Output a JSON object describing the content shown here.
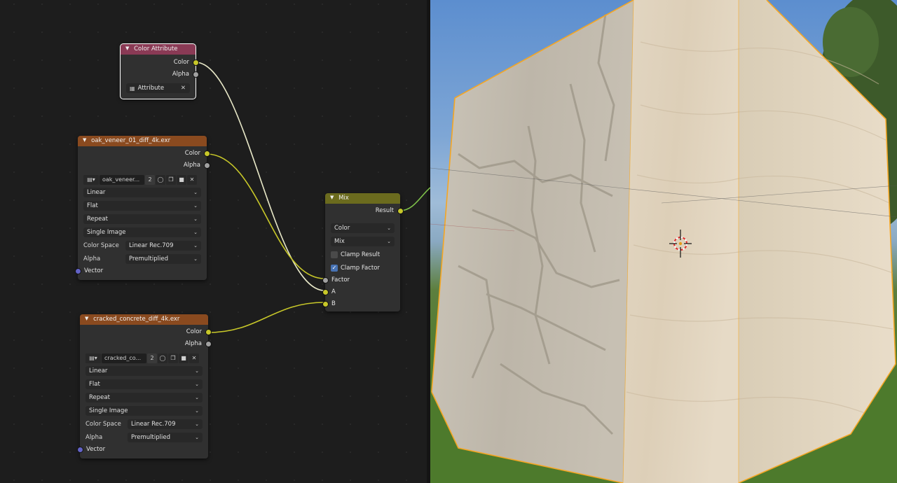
{
  "color_attribute_node": {
    "title": "Color Attribute",
    "outputs": {
      "color": "Color",
      "alpha": "Alpha"
    },
    "attribute_field": "Attribute",
    "header_color": "#8a3a55"
  },
  "oak_node": {
    "title": "oak_veneer_01_diff_4k.exr",
    "outputs": {
      "color": "Color",
      "alpha": "Alpha"
    },
    "image_name": "oak_veneer...",
    "users": "2",
    "interpolation": "Linear",
    "projection": "Flat",
    "extension": "Repeat",
    "source": "Single Image",
    "color_space_label": "Color Space",
    "color_space": "Linear Rec.709",
    "alpha_label": "Alpha",
    "alpha": "Premultiplied",
    "vector_input": "Vector",
    "header_color": "#8a4a1f"
  },
  "concrete_node": {
    "title": "cracked_concrete_diff_4k.exr",
    "outputs": {
      "color": "Color",
      "alpha": "Alpha"
    },
    "image_name": "cracked_co...",
    "users": "2",
    "interpolation": "Linear",
    "projection": "Flat",
    "extension": "Repeat",
    "source": "Single Image",
    "color_space_label": "Color Space",
    "color_space": "Linear Rec.709",
    "alpha_label": "Alpha",
    "alpha": "Premultiplied",
    "vector_input": "Vector",
    "header_color": "#8a4a1f"
  },
  "mix_node": {
    "title": "Mix",
    "output": "Result",
    "data_type": "Color",
    "blend_mode": "Mix",
    "clamp_result": "Clamp Result",
    "clamp_result_checked": false,
    "clamp_factor": "Clamp Factor",
    "clamp_factor_checked": true,
    "inputs": {
      "factor": "Factor",
      "a": "A",
      "b": "B"
    },
    "header_color": "#6b6b1e"
  },
  "colors": {
    "socket_color": "#c7c729",
    "socket_float": "#a1a1a1",
    "socket_vector": "#6363c7",
    "selection_outline": "#f5a623",
    "link_yellow": "#c7c729",
    "link_selected": "#e8e8c8"
  },
  "icons": [
    "image-browse-icon",
    "fake-user-shield-icon",
    "duplicate-icon",
    "open-folder-icon",
    "unlink-x-icon",
    "attribute-icon",
    "chevron-down-icon",
    "3d-cursor-icon"
  ]
}
